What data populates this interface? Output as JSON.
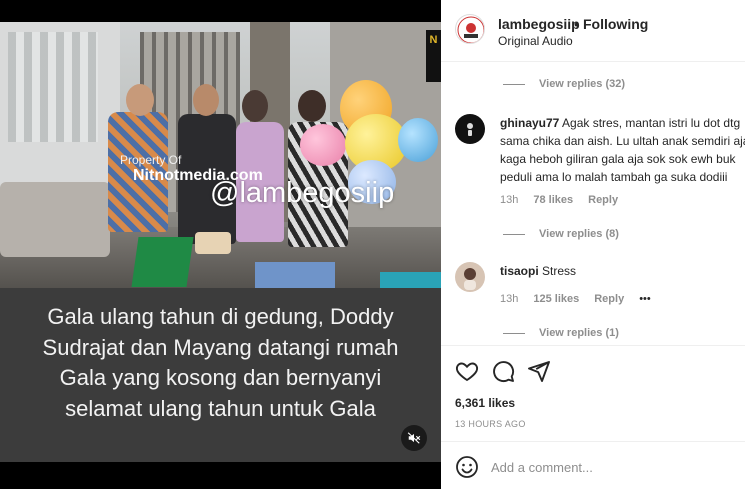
{
  "video": {
    "watermark_small": "Property Of",
    "watermark_site": "Nitnotmedia.com",
    "watermark_handle": "@lambegosiip",
    "corner_logo": "N",
    "caption_lines": [
      "Gala ulang tahun di gedung, Doddy",
      "Sudrajat dan Mayang datangi rumah",
      "Gala yang kosong dan bernyanyi",
      "selamat ulang tahun untuk Gala"
    ],
    "mute_icon": "speaker-muted-icon"
  },
  "header": {
    "username": "lambegosiip",
    "dot": "•",
    "follow_status": "Following",
    "audio": "Original Audio"
  },
  "comments": {
    "view_replies_1": "View replies (32)",
    "c1": {
      "username": "ghinayu77",
      "text": "Agak stres, mantan istri lu dot dtg sama chika dan aish. Lu ultah anak semdiri aja kaga heboh giliran gala aja sok sok ewh buk peduli ama lo malah tambah ga suka dodiii",
      "time": "13h",
      "likes": "78 likes",
      "reply": "Reply"
    },
    "view_replies_2": "View replies (8)",
    "c2": {
      "username": "tisaopi",
      "text": "Stress",
      "time": "13h",
      "likes": "125 likes",
      "reply": "Reply",
      "more": "•••"
    },
    "view_replies_3": "View replies (1)"
  },
  "actions": {
    "icons": [
      "heart-icon",
      "comment-icon",
      "share-icon"
    ],
    "likes": "6,361 likes",
    "timestamp": "13 HOURS AGO"
  },
  "add_comment": {
    "placeholder": "Add a comment...",
    "emoji_icon": "emoji-icon"
  },
  "colors": {
    "text": "#262626",
    "secondary": "#8e8e8e",
    "border": "#efefef",
    "caption_bg": "#3c3c3c"
  }
}
